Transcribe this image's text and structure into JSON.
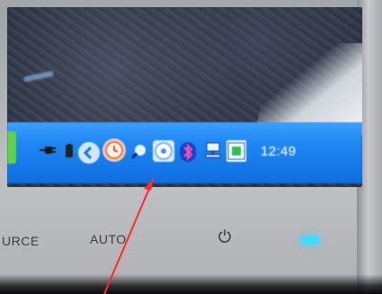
{
  "photo": {
    "taskbar": {
      "clock_time": "12:49",
      "icons": [
        "plug-icon",
        "battery-icon",
        "back-arrow-icon",
        "clock-icon",
        "search-icon",
        "cd-drive-icon",
        "bluetooth-icon",
        "network-icon",
        "app-window-icon"
      ]
    },
    "monitor_labels": {
      "source_label": "URCE",
      "auto_label": "AUTO"
    },
    "annotation": {
      "arrow_color": "#ff2a2a"
    },
    "colors": {
      "taskbar_blue": "#1f86f2",
      "bezel_gray": "#bfc1c4",
      "power_led": "#41d9ff"
    }
  }
}
